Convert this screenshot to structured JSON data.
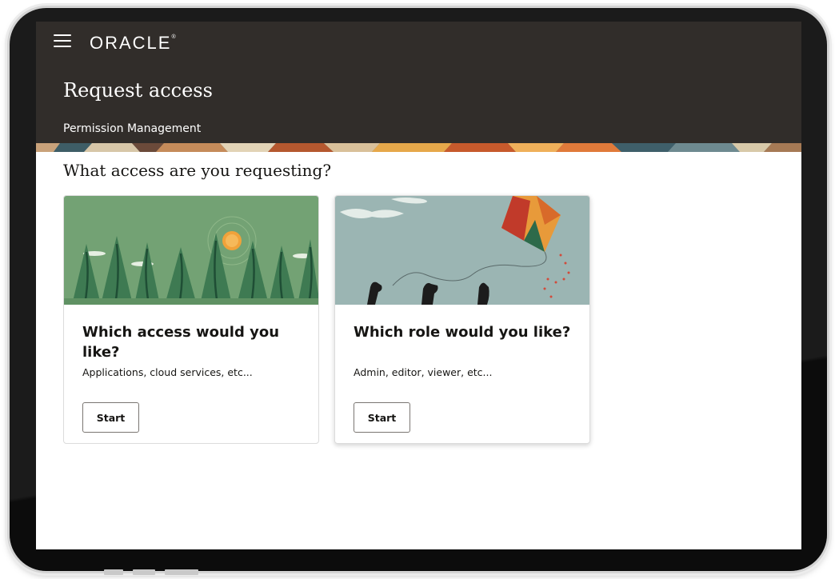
{
  "header": {
    "logo_text": "ORACLE",
    "logo_mark": "®",
    "menu_icon": "hamburger-menu-icon",
    "title": "Request access",
    "subtitle": "Permission Management",
    "background_color": "#312d2a"
  },
  "main": {
    "question": "What access are you requesting?",
    "cards": [
      {
        "title": "Which access would you like?",
        "description": "Applications, cloud services, etc...",
        "button_label": "Start",
        "illustration": "forest-sun-illustration"
      },
      {
        "title": "Which role would you like?",
        "description": "Admin, editor, viewer, etc...",
        "button_label": "Start",
        "illustration": "hands-kite-illustration"
      }
    ]
  },
  "colors": {
    "text": "#161513",
    "card_border": "#dcdcdc",
    "button_border": "#7a7672"
  }
}
